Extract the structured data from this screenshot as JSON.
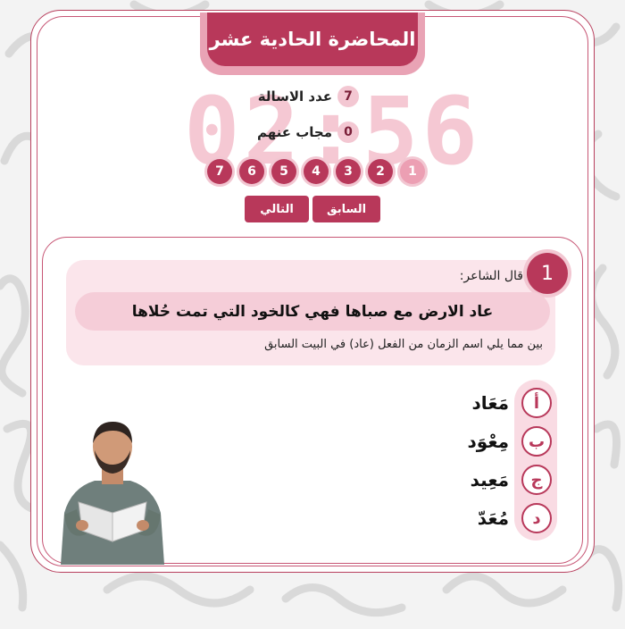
{
  "lecture": {
    "title": "المحاضرة الحادية عشر"
  },
  "timer": {
    "display": "02:56"
  },
  "stats": {
    "total_label": "عدد الاسالة",
    "total_value": "7",
    "answered_label": "مجاب عنهم",
    "answered_value": "0"
  },
  "question_nav": [
    "1",
    "2",
    "3",
    "4",
    "5",
    "6",
    "7"
  ],
  "nav": {
    "prev_label": "السابق",
    "next_label": "التالي"
  },
  "question": {
    "number": "1",
    "intro": "قال الشاعر:",
    "verse": "عاد الارض مع صباها فهي كالخود التي تمت حُلاها",
    "prompt": "بين مما يلي اسم الزمان من الفعل (عاد) في البيت السابق"
  },
  "options": [
    {
      "letter": "أ",
      "text": "مَعَاد"
    },
    {
      "letter": "ب",
      "text": "مِعْوَد"
    },
    {
      "letter": "ج",
      "text": "مَعِيد"
    },
    {
      "letter": "د",
      "text": "مُعَدّ"
    }
  ],
  "colors": {
    "accent": "#b8385a",
    "accent_light": "#f5cdd8",
    "timer": "#f5c8d3"
  }
}
